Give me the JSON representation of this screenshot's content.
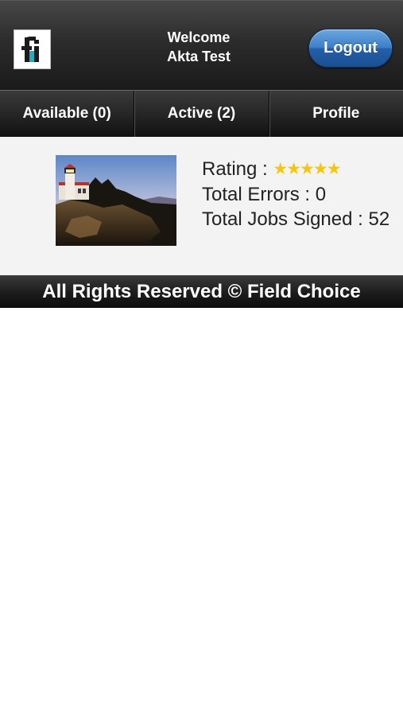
{
  "header": {
    "logo_icon": "fi-logo",
    "welcome_line1": "Welcome",
    "welcome_line2": "Akta Test",
    "logout_label": "Logout"
  },
  "tabs": [
    {
      "label": "Available (0)"
    },
    {
      "label": "Active (2)"
    },
    {
      "label": "Profile"
    }
  ],
  "profile": {
    "photo": "lighthouse-photo",
    "rating_label": "Rating :",
    "rating_stars": 5,
    "rating_stars_text": "★★★★★",
    "errors_text": "Total Errors : 0",
    "jobs_label": "Total Jobs Signed :",
    "jobs_value": "52"
  },
  "footer": {
    "text": "All Rights Reserved © Field Choice"
  },
  "colors": {
    "accent_button": "#2f6db6",
    "star": "#f2c80f",
    "panel_bg": "#f3f3f3"
  }
}
